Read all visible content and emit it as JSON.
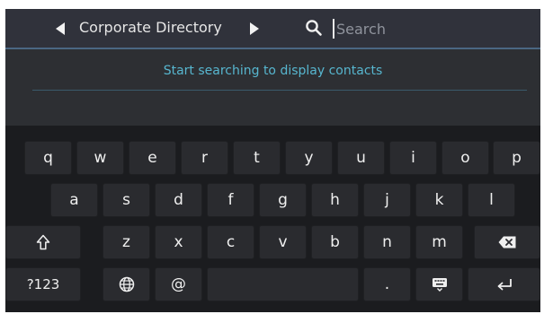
{
  "header": {
    "title": "Corporate Directory",
    "prev_icon": "arrow-left-icon",
    "next_icon": "arrow-right-icon",
    "search_icon": "search-icon"
  },
  "search": {
    "placeholder": "Search",
    "value": ""
  },
  "main": {
    "hint": "Start searching to display contacts"
  },
  "keyboard": {
    "row1": [
      "q",
      "w",
      "e",
      "r",
      "t",
      "y",
      "u",
      "i",
      "o",
      "p"
    ],
    "row2": [
      "a",
      "s",
      "d",
      "f",
      "g",
      "h",
      "j",
      "k",
      "l"
    ],
    "row3": [
      "z",
      "x",
      "c",
      "v",
      "b",
      "n",
      "m"
    ],
    "shift_icon": "shift-icon",
    "backspace_icon": "backspace-icon",
    "symbols_label": "?123",
    "globe_icon": "globe-icon",
    "at_label": "@",
    "period_label": ".",
    "hide_keyboard_icon": "keyboard-hide-icon",
    "enter_icon": "enter-icon"
  },
  "colors": {
    "screen_bg": "#2d2f33",
    "keyboard_bg": "#1b1c1f",
    "key_bg": "#2a2b2f",
    "accent": "#57b6cf"
  }
}
